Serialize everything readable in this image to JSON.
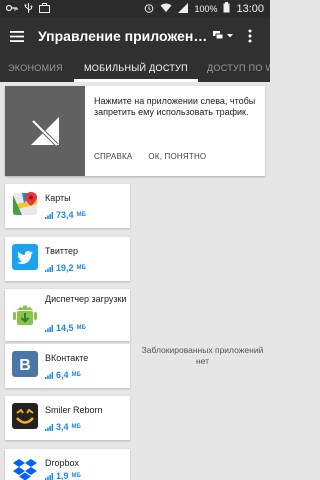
{
  "status_bar": {
    "battery_label": "100%",
    "time": "13:00"
  },
  "app_bar": {
    "title": "Управление приложени…",
    "menu_icon": "hamburger-icon",
    "actions": [
      "sort-icon",
      "more-vert-icon"
    ]
  },
  "tabs": [
    {
      "label": "ЭКОНОМИЯ",
      "active": false
    },
    {
      "label": "МОБИЛЬНЫЙ ДОСТУП",
      "active": true
    },
    {
      "label": "ДОСТУП ПО W",
      "active": false
    }
  ],
  "info_card": {
    "text": "Нажмите на приложении слева, чтобы запретить ему использовать трафик.",
    "help_label": "СПРАВКА",
    "ok_label": "ОК, ПОНЯТНО"
  },
  "apps": [
    {
      "name": "Карты",
      "data": "73,4",
      "unit": "МБ",
      "icon": "google-maps-icon"
    },
    {
      "name": "Твиттер",
      "data": "19,2",
      "unit": "МБ",
      "icon": "twitter-icon"
    },
    {
      "name": "Диспетчер загрузки",
      "data": "14,5",
      "unit": "МБ",
      "icon": "android-download-manager-icon"
    },
    {
      "name": "ВКонтакте",
      "data": "6,4",
      "unit": "МБ",
      "icon": "vk-icon"
    },
    {
      "name": "Smiler Reborn",
      "data": "3,4",
      "unit": "МБ",
      "icon": "smiler-icon"
    },
    {
      "name": "Dropbox",
      "data": "1,9",
      "unit": "МБ",
      "icon": "dropbox-icon"
    }
  ],
  "blocked_empty_text": "Заблокированных приложений нет",
  "colors": {
    "app_bar": "#303030",
    "accent_blue": "#1e88e5",
    "background": "#e6e6e6"
  }
}
